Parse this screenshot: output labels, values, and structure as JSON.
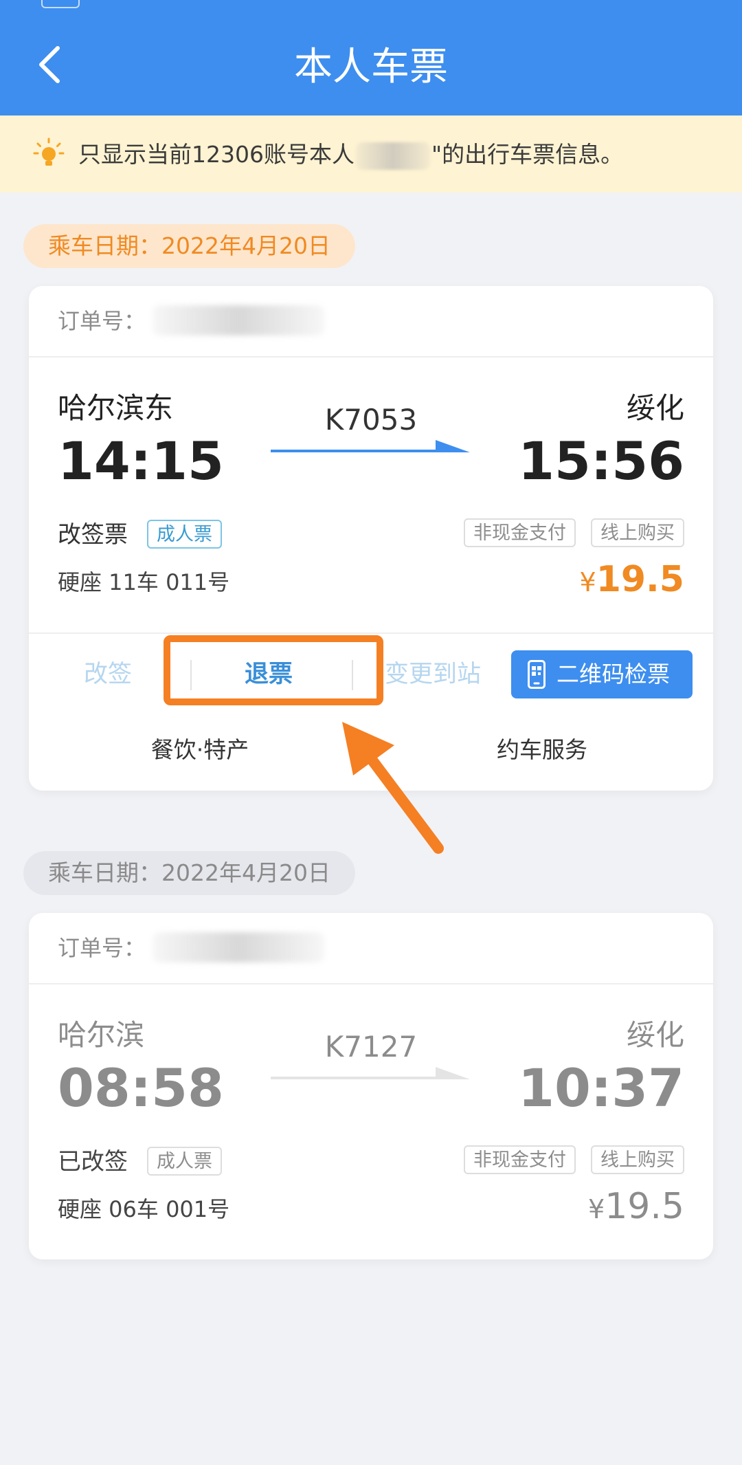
{
  "header": {
    "title": "本人车票"
  },
  "notice": {
    "text_before": "只显示当前12306账号本人",
    "text_after": "\"的出行车票信息。"
  },
  "tickets": [
    {
      "date_label": "乘车日期：2022年4月20日",
      "order_label": "订单号：",
      "from_station": "哈尔滨东",
      "to_station": "绥化",
      "departure_time": "14:15",
      "arrival_time": "15:56",
      "train_number": "K7053",
      "ticket_type": "改签票",
      "passenger_tag": "成人票",
      "payment_tag": "非现金支付",
      "purchase_tag": "线上购买",
      "seat": "硬座 11车 011号",
      "currency": "¥",
      "price": "19.5",
      "actions": {
        "change": "改签",
        "refund": "退票",
        "change_station": "变更到站",
        "qr_check": "二维码检票"
      },
      "services": {
        "food": "餐饮·特产",
        "car": "约车服务"
      }
    },
    {
      "date_label": "乘车日期：2022年4月20日",
      "order_label": "订单号：",
      "from_station": "哈尔滨",
      "to_station": "绥化",
      "departure_time": "08:58",
      "arrival_time": "10:37",
      "train_number": "K7127",
      "ticket_type": "已改签",
      "passenger_tag": "成人票",
      "payment_tag": "非现金支付",
      "purchase_tag": "线上购买",
      "seat": "硬座 06车 001号",
      "currency": "¥",
      "price": "19.5"
    }
  ],
  "colors": {
    "header_blue": "#3d8eef",
    "notice_bg": "#fef3d2",
    "accent_orange": "#f08a22",
    "highlight_orange": "#f57f23"
  },
  "icons": [
    "back-arrow-icon",
    "lightbulb-icon",
    "train-arrow-icon",
    "qr-phone-icon",
    "pointer-arrow-icon"
  ]
}
